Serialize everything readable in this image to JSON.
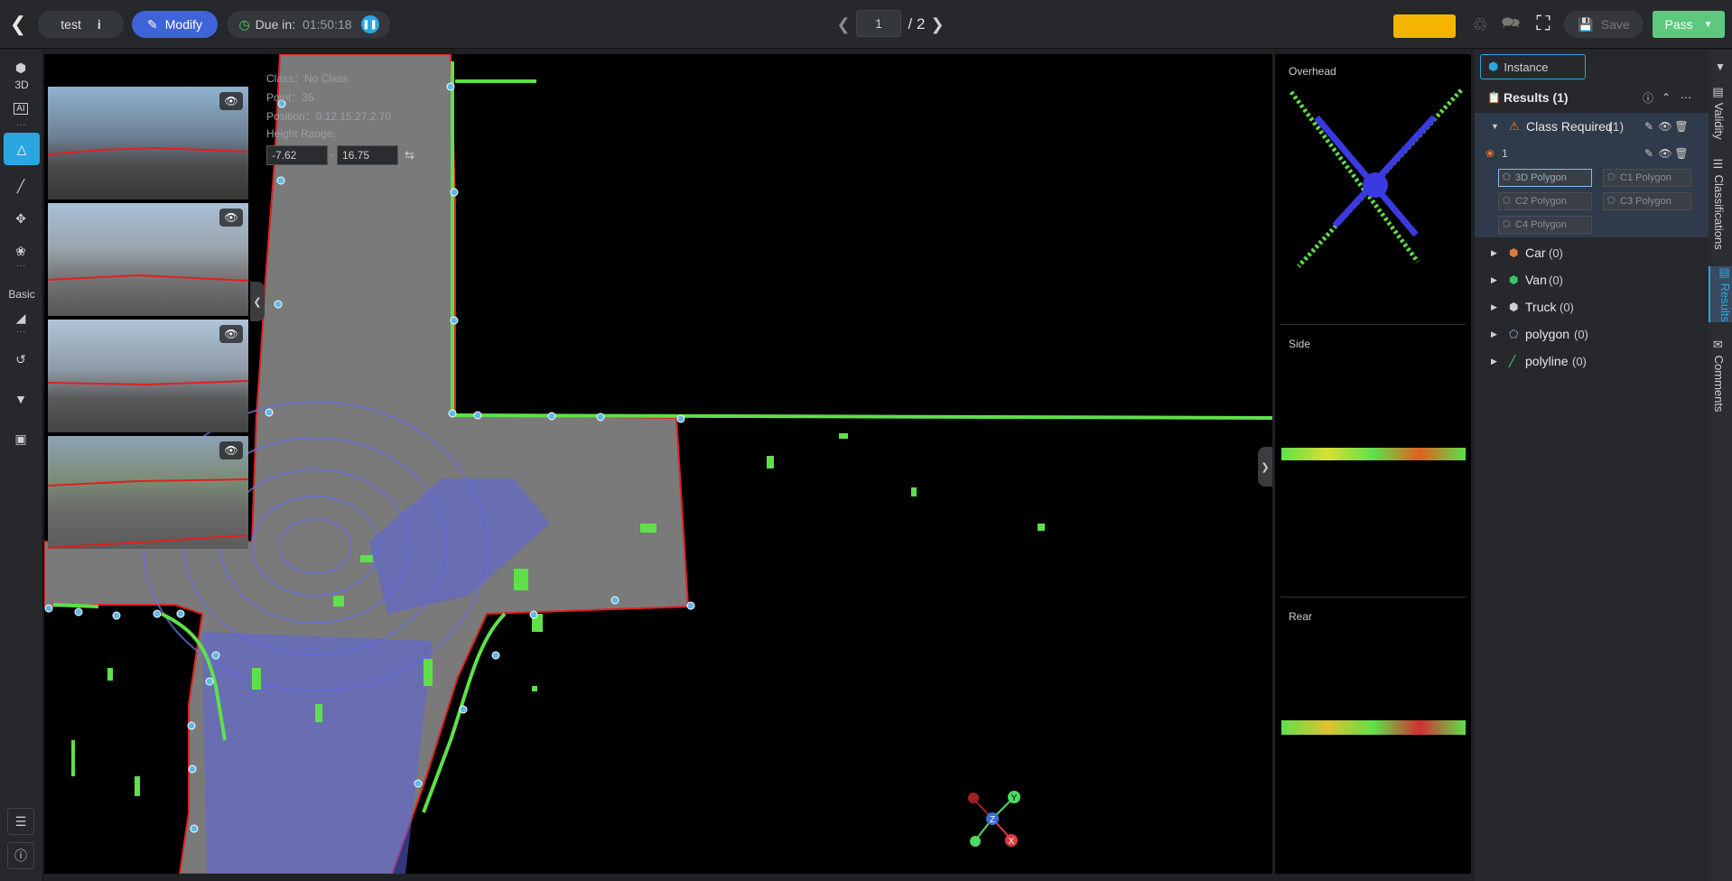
{
  "topbar": {
    "back_icon": "chevron-left-icon",
    "task_name": "test",
    "mode_label": "Modify",
    "due_label": "Due in:",
    "due_time": "01:50:18",
    "page_current": "1",
    "page_total": "/ 2",
    "save_label": "Save",
    "pass_label": "Pass",
    "accent_color": "#f5b400",
    "pass_color": "#5cc97e"
  },
  "toolbar": {
    "label_3d": "3D",
    "label_ai": "AI",
    "label_basic": "Basic"
  },
  "overlay_info": {
    "class_line": "Class：No Class",
    "point_line": "Point：35",
    "position_line": "Position：0.12,15.27,2.70",
    "height_range_label": "Height Range:",
    "height_min": "-7.62",
    "height_max": "16.75",
    "range_sep": "-"
  },
  "views": {
    "overhead": "Overhead",
    "side": "Side",
    "rear": "Rear"
  },
  "axes": {
    "x": "X",
    "y": "Y",
    "z": "Z"
  },
  "right_panel": {
    "instance_tab": "Instance",
    "results_title": "Results (1)",
    "class_required": "Class Required",
    "class_required_count": "(1)",
    "instance_id": "1",
    "tags": [
      "3D Polygon",
      "C1 Polygon",
      "C2 Polygon",
      "C3 Polygon",
      "C4 Polygon"
    ],
    "classes": [
      {
        "name": "Car",
        "count": "(0)",
        "color": "#e07b39"
      },
      {
        "name": "Van",
        "count": "(0)",
        "color": "#3cc46b"
      },
      {
        "name": "Truck",
        "count": "(0)",
        "color": "#cfcfcf"
      },
      {
        "name": "polygon",
        "count": "(0)",
        "color": "#9bb0c8"
      },
      {
        "name": "polyline",
        "count": "(0)",
        "color": "#4cd964"
      }
    ]
  },
  "side_tabs": {
    "validity": "Validity",
    "classifications": "Classifications",
    "results": "Results",
    "comments": "Comments"
  }
}
